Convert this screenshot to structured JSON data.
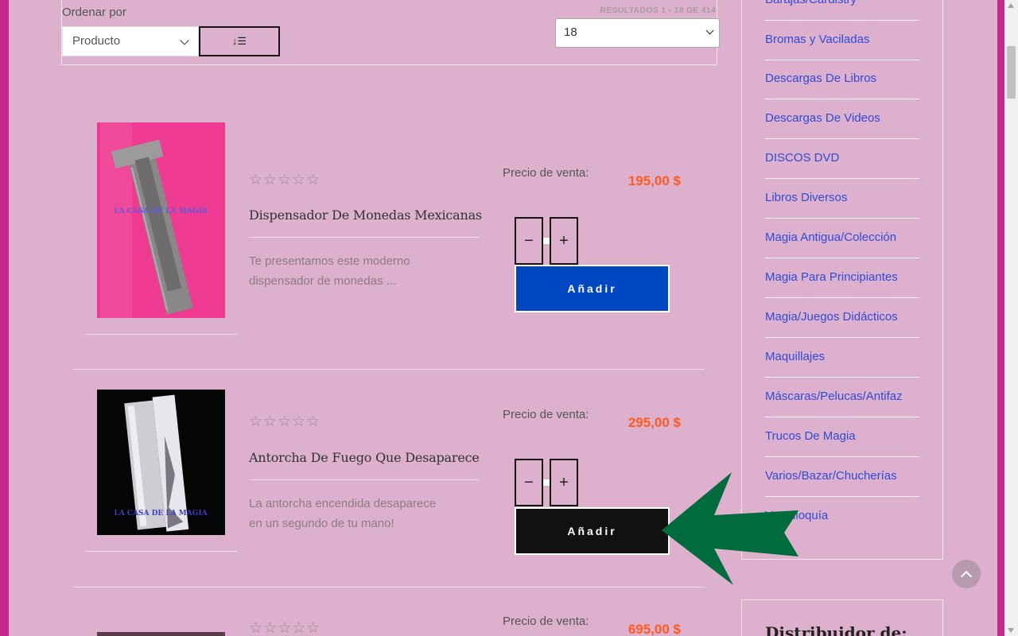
{
  "toolbar": {
    "order_label": "Ordenar por",
    "order_value": "Producto",
    "sort_icon": "↓☰",
    "results_count": "RESULTADOS 1 - 18 DE 414",
    "per_page_value": "18"
  },
  "products": [
    {
      "title": "Dispensador De Monedas Mexicanas",
      "description": "Te presentamos este moderno dispensador de monedas ...",
      "price_label": "Precio de venta:",
      "price": "195,00 $",
      "rating_stars": "☆☆☆☆☆",
      "add_label": "Añadir",
      "add_color": "#0047c2",
      "image_watermark": "LA CASA DE LA MAGIA"
    },
    {
      "title": "Antorcha De Fuego Que Desaparece",
      "description": "La antorcha encendida desaparece en un segundo de tu mano!",
      "price_label": "Precio de venta:",
      "price": "295,00 $",
      "rating_stars": "☆☆☆☆☆",
      "add_label": "Añadir",
      "add_color": "#111111",
      "image_watermark": "LA CASA DE LA MAGIA"
    },
    {
      "title": "",
      "description": "",
      "price_label": "Precio de venta:",
      "price": "695,00 $",
      "rating_stars": "☆☆☆☆☆"
    }
  ],
  "qty": {
    "minus": "−",
    "plus": "+"
  },
  "sidebar": {
    "categories": [
      "Barajas/Cardistry",
      "Bromas y Vaciladas",
      "Descargas De Libros",
      "Descargas De Videos",
      "DISCOS DVD",
      "Libros Diversos",
      "Magia Antigua/Colección",
      "Magia Para Principiantes",
      "Magia/Juegos Didácticos",
      "Maquillajes",
      "Máscaras/Pelucas/Antifaz",
      "Trucos De Magia",
      "Varios/Bazar/Chucherías",
      "Ventriloquía"
    ],
    "distributor_title": "Distribuidor de:"
  },
  "colors": {
    "page_bg": "#ddb0cd",
    "outer_bg": "#c2288d",
    "price": "#ff5a1f",
    "link": "#2e4bd8",
    "annotation_arrow": "#006b3c"
  }
}
